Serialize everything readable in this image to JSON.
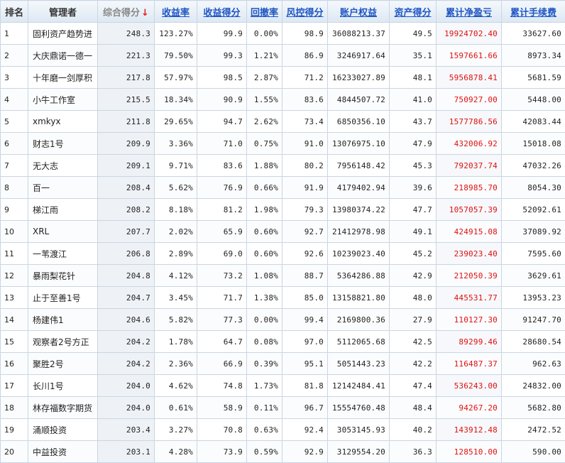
{
  "columns": [
    {
      "key": "rank",
      "label": "排名"
    },
    {
      "key": "manager",
      "label": "管理者"
    },
    {
      "key": "score",
      "label": "综合得分"
    },
    {
      "key": "return_rate",
      "label": "收益率"
    },
    {
      "key": "return_score",
      "label": "收益得分"
    },
    {
      "key": "drawdown",
      "label": "回撤率"
    },
    {
      "key": "risk_score",
      "label": "风控得分"
    },
    {
      "key": "equity",
      "label": "账户权益"
    },
    {
      "key": "asset_score",
      "label": "资产得分"
    },
    {
      "key": "net_profit",
      "label": "累计净盈亏"
    },
    {
      "key": "fees",
      "label": "累计手续费"
    }
  ],
  "sort_indicator": "↓",
  "rows": [
    {
      "rank": "1",
      "manager": "固利资产趋势进",
      "score": "248.3",
      "return_rate": "123.27%",
      "return_score": "99.9",
      "drawdown": "0.00%",
      "risk_score": "98.9",
      "equity": "36088213.37",
      "asset_score": "49.5",
      "net_profit": "19924702.40",
      "fees": "33627.60"
    },
    {
      "rank": "2",
      "manager": "大庆鼎诺一德一",
      "score": "221.3",
      "return_rate": "79.50%",
      "return_score": "99.3",
      "drawdown": "1.21%",
      "risk_score": "86.9",
      "equity": "3246917.64",
      "asset_score": "35.1",
      "net_profit": "1597661.66",
      "fees": "8973.34"
    },
    {
      "rank": "3",
      "manager": "十年磨一剑厚积",
      "score": "217.8",
      "return_rate": "57.97%",
      "return_score": "98.5",
      "drawdown": "2.87%",
      "risk_score": "71.2",
      "equity": "16233027.89",
      "asset_score": "48.1",
      "net_profit": "5956878.41",
      "fees": "5681.59"
    },
    {
      "rank": "4",
      "manager": "小牛工作室",
      "score": "215.5",
      "return_rate": "18.34%",
      "return_score": "90.9",
      "drawdown": "1.55%",
      "risk_score": "83.6",
      "equity": "4844507.72",
      "asset_score": "41.0",
      "net_profit": "750927.00",
      "fees": "5448.00"
    },
    {
      "rank": "5",
      "manager": "xmkyx",
      "score": "211.8",
      "return_rate": "29.65%",
      "return_score": "94.7",
      "drawdown": "2.62%",
      "risk_score": "73.4",
      "equity": "6850356.10",
      "asset_score": "43.7",
      "net_profit": "1577786.56",
      "fees": "42083.44"
    },
    {
      "rank": "6",
      "manager": "财志1号",
      "score": "209.9",
      "return_rate": "3.36%",
      "return_score": "71.0",
      "drawdown": "0.75%",
      "risk_score": "91.0",
      "equity": "13076975.10",
      "asset_score": "47.9",
      "net_profit": "432006.92",
      "fees": "15018.08"
    },
    {
      "rank": "7",
      "manager": "无大志",
      "score": "209.1",
      "return_rate": "9.71%",
      "return_score": "83.6",
      "drawdown": "1.88%",
      "risk_score": "80.2",
      "equity": "7956148.42",
      "asset_score": "45.3",
      "net_profit": "792037.74",
      "fees": "47032.26"
    },
    {
      "rank": "8",
      "manager": "百一",
      "score": "208.4",
      "return_rate": "5.62%",
      "return_score": "76.9",
      "drawdown": "0.66%",
      "risk_score": "91.9",
      "equity": "4179402.94",
      "asset_score": "39.6",
      "net_profit": "218985.70",
      "fees": "8054.30"
    },
    {
      "rank": "9",
      "manager": "梯江雨",
      "score": "208.2",
      "return_rate": "8.18%",
      "return_score": "81.2",
      "drawdown": "1.98%",
      "risk_score": "79.3",
      "equity": "13980374.22",
      "asset_score": "47.7",
      "net_profit": "1057057.39",
      "fees": "52092.61"
    },
    {
      "rank": "10",
      "manager": "XRL",
      "score": "207.7",
      "return_rate": "2.02%",
      "return_score": "65.9",
      "drawdown": "0.60%",
      "risk_score": "92.7",
      "equity": "21412978.98",
      "asset_score": "49.1",
      "net_profit": "424915.08",
      "fees": "37089.92"
    },
    {
      "rank": "11",
      "manager": "一苇渡江",
      "score": "206.8",
      "return_rate": "2.89%",
      "return_score": "69.0",
      "drawdown": "0.60%",
      "risk_score": "92.6",
      "equity": "10239023.40",
      "asset_score": "45.2",
      "net_profit": "239023.40",
      "fees": "7595.60"
    },
    {
      "rank": "12",
      "manager": "暴雨梨花针",
      "score": "204.8",
      "return_rate": "4.12%",
      "return_score": "73.2",
      "drawdown": "1.08%",
      "risk_score": "88.7",
      "equity": "5364286.88",
      "asset_score": "42.9",
      "net_profit": "212050.39",
      "fees": "3629.61"
    },
    {
      "rank": "13",
      "manager": "止于至善1号",
      "score": "204.7",
      "return_rate": "3.45%",
      "return_score": "71.7",
      "drawdown": "1.38%",
      "risk_score": "85.0",
      "equity": "13158821.80",
      "asset_score": "48.0",
      "net_profit": "445531.77",
      "fees": "13953.23"
    },
    {
      "rank": "14",
      "manager": "杨建伟1",
      "score": "204.6",
      "return_rate": "5.82%",
      "return_score": "77.3",
      "drawdown": "0.00%",
      "risk_score": "99.4",
      "equity": "2169800.36",
      "asset_score": "27.9",
      "net_profit": "110127.30",
      "fees": "91247.70"
    },
    {
      "rank": "15",
      "manager": "观察者2号方正",
      "score": "204.2",
      "return_rate": "1.78%",
      "return_score": "64.7",
      "drawdown": "0.08%",
      "risk_score": "97.0",
      "equity": "5112065.68",
      "asset_score": "42.5",
      "net_profit": "89299.46",
      "fees": "28680.54"
    },
    {
      "rank": "16",
      "manager": "聚胜2号",
      "score": "204.2",
      "return_rate": "2.36%",
      "return_score": "66.9",
      "drawdown": "0.39%",
      "risk_score": "95.1",
      "equity": "5051443.23",
      "asset_score": "42.2",
      "net_profit": "116487.37",
      "fees": "962.63"
    },
    {
      "rank": "17",
      "manager": "长川1号",
      "score": "204.0",
      "return_rate": "4.62%",
      "return_score": "74.8",
      "drawdown": "1.73%",
      "risk_score": "81.8",
      "equity": "12142484.41",
      "asset_score": "47.4",
      "net_profit": "536243.00",
      "fees": "24832.00"
    },
    {
      "rank": "18",
      "manager": "林存福数字期货",
      "score": "204.0",
      "return_rate": "0.61%",
      "return_score": "58.9",
      "drawdown": "0.11%",
      "risk_score": "96.7",
      "equity": "15554760.48",
      "asset_score": "48.4",
      "net_profit": "94267.20",
      "fees": "5682.80"
    },
    {
      "rank": "19",
      "manager": "涌顺投资",
      "score": "203.4",
      "return_rate": "3.27%",
      "return_score": "70.8",
      "drawdown": "0.63%",
      "risk_score": "92.4",
      "equity": "3053145.93",
      "asset_score": "40.2",
      "net_profit": "143912.48",
      "fees": "2472.52"
    },
    {
      "rank": "20",
      "manager": "中益投资",
      "score": "203.1",
      "return_rate": "4.28%",
      "return_score": "73.9",
      "drawdown": "0.59%",
      "risk_score": "92.9",
      "equity": "3129554.20",
      "asset_score": "36.3",
      "net_profit": "128510.00",
      "fees": "590.00"
    }
  ],
  "colors": {
    "link": "#1f56c3",
    "profit": "#e01010",
    "sort_arrow": "#e02020",
    "border": "#c9d6e3"
  }
}
